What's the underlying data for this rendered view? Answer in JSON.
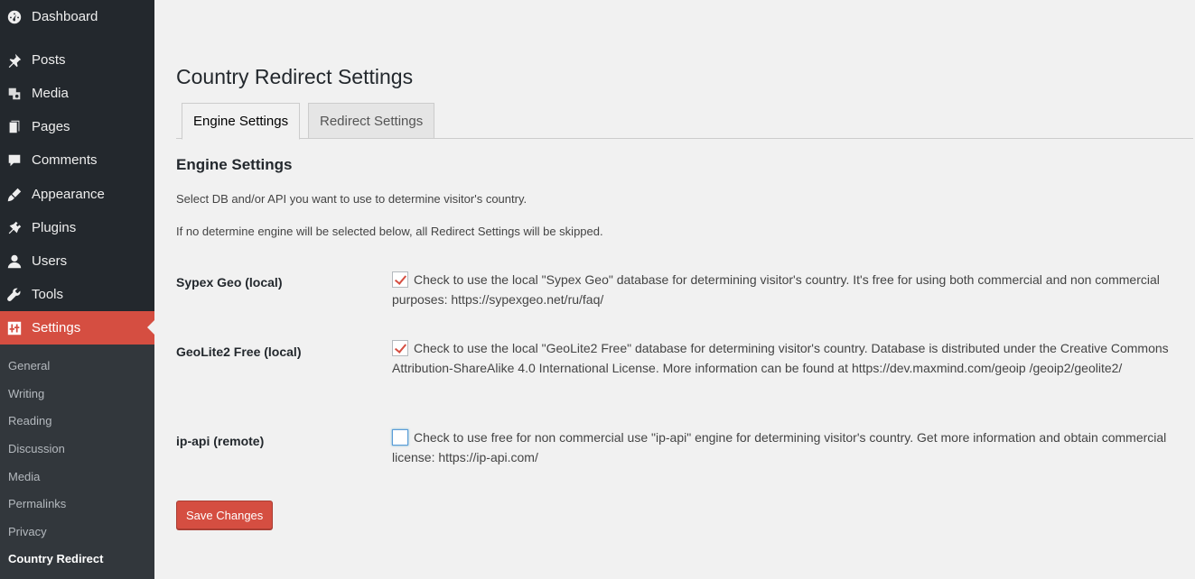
{
  "sidebar": {
    "items": [
      {
        "label": "Dashboard",
        "icon": "dashboard-icon"
      },
      {
        "label": "Posts",
        "icon": "pin-icon"
      },
      {
        "label": "Media",
        "icon": "media-icon"
      },
      {
        "label": "Pages",
        "icon": "pages-icon"
      },
      {
        "label": "Comments",
        "icon": "comment-icon"
      },
      {
        "label": "Appearance",
        "icon": "brush-icon"
      },
      {
        "label": "Plugins",
        "icon": "plug-icon"
      },
      {
        "label": "Users",
        "icon": "user-icon"
      },
      {
        "label": "Tools",
        "icon": "wrench-icon"
      },
      {
        "label": "Settings",
        "icon": "settings-icon"
      }
    ],
    "submenu": [
      "General",
      "Writing",
      "Reading",
      "Discussion",
      "Media",
      "Permalinks",
      "Privacy",
      "Country Redirect"
    ],
    "active_color": "#d54e41"
  },
  "page": {
    "title": "Country Redirect Settings",
    "tabs": [
      {
        "label": "Engine Settings",
        "active": true
      },
      {
        "label": "Redirect Settings",
        "active": false
      }
    ],
    "section_title": "Engine Settings",
    "desc1": "Select DB and/or API you want to use to determine visitor's country.",
    "desc2": "If no determine engine will be selected below, all Redirect Settings will be skipped.",
    "rows": [
      {
        "label": "Sypex Geo (local)",
        "checked": true,
        "text": "Check to use the local \"Sypex Geo\" database for determining visitor's country. It's free for using both commercial and non commercial purposes: https://sypexgeo.net/ru/faq/"
      },
      {
        "label": "GeoLite2 Free (local)",
        "checked": true,
        "text": "Check to use the local \"GeoLite2 Free\" database for determining visitor's country. Database is distributed under the Creative Commons Attribution-ShareAlike 4.0 International License. More information can be found at https://dev.maxmind.com/geoip /geoip2/geolite2/"
      },
      {
        "label": "ip-api (remote)",
        "checked": false,
        "text": "Check to use free for non commercial use \"ip-api\" engine for determining visitor's country. Get more information and obtain commercial license: https://ip-api.com/"
      }
    ],
    "save_label": "Save Changes"
  }
}
